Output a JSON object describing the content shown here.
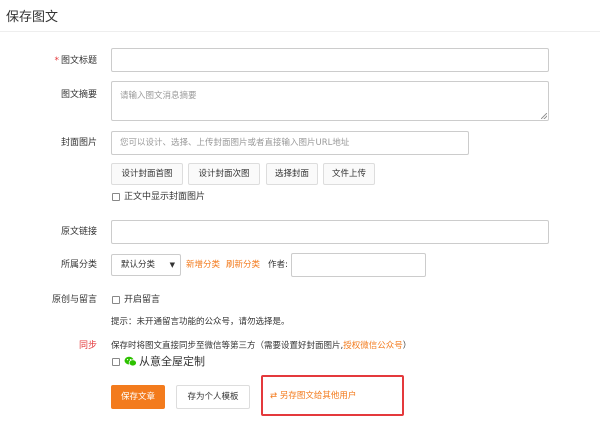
{
  "header": {
    "title": "保存图文"
  },
  "form": {
    "title": {
      "required_mark": "*",
      "label": "图文标题",
      "value": "",
      "placeholder": ""
    },
    "summary": {
      "label": "图文摘要",
      "placeholder": "请输入图文消息摘要"
    },
    "cover": {
      "label": "封面图片",
      "placeholder": "您可以设计、选择、上传封面图片或者直接输入图片URL地址",
      "buttons": [
        "设计封面首图",
        "设计封面次图",
        "选择封面",
        "文件上传"
      ],
      "show_in_body_label": "正文中显示封面图片"
    },
    "source_link": {
      "label": "原文链接",
      "value": ""
    },
    "category": {
      "label": "所属分类",
      "selected": "默认分类",
      "add_link": "新增分类",
      "refresh_link": "刷新分类",
      "author_label": "作者:",
      "author_value": ""
    },
    "comments": {
      "label": "原创与留言",
      "enable_label": "开启留言",
      "hint": "提示：未开通留言功能的公众号，请勿选择是。"
    },
    "sync": {
      "label": "同步",
      "description": "保存时将图文直接同步至微信等第三方（需要设置好封面图片,",
      "auth_link": "授权微信公众号",
      "description_end": "）",
      "wechat_label": "从意全屋定制"
    },
    "actions": {
      "save": "保存文章",
      "save_template": "存为个人模板",
      "share_icon": "⇄",
      "share_label": "另存图文给其他用户"
    }
  },
  "colors": {
    "accent": "#f37b1d",
    "danger": "#e4393c",
    "wechat": "#2dc100"
  }
}
